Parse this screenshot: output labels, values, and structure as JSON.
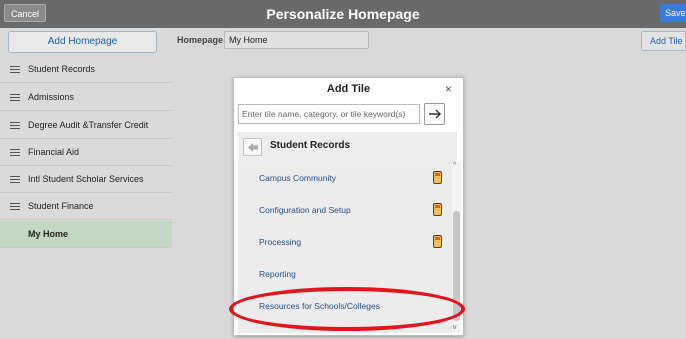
{
  "header": {
    "title": "Personalize Homepage",
    "cancel_label": "Cancel",
    "save_label": "Save"
  },
  "sidebar": {
    "add_homepage_label": "Add Homepage",
    "items": [
      {
        "label": "Student Records"
      },
      {
        "label": "Admissions"
      },
      {
        "label": "Degree Audit &Transfer Credit"
      },
      {
        "label": "Financial Aid"
      },
      {
        "label": "Intl Student Scholar Services"
      },
      {
        "label": "Student Finance"
      },
      {
        "label": "My Home",
        "selected": true
      }
    ]
  },
  "main": {
    "homepage_label": "Homepage",
    "homepage_value": "My Home",
    "add_tile_label": "Add Tile"
  },
  "modal": {
    "title": "Add Tile",
    "close": "×",
    "search_placeholder": "Enter tile name, category, or tile keyword(s)",
    "crumb": "Student Records",
    "items": [
      {
        "label": "Campus Community",
        "has_device_icon": true
      },
      {
        "label": "Configuration and Setup",
        "has_device_icon": true
      },
      {
        "label": "Processing",
        "has_device_icon": true
      },
      {
        "label": "Reporting",
        "has_device_icon": false
      },
      {
        "label": "Resources for Schools/Colleges",
        "has_device_icon": false
      }
    ]
  },
  "colors": {
    "header_bg": "#6a6a6a",
    "accent_blue": "#3a7bd5",
    "selected_green": "#c3d8c2",
    "highlight_red": "#e3141b"
  }
}
